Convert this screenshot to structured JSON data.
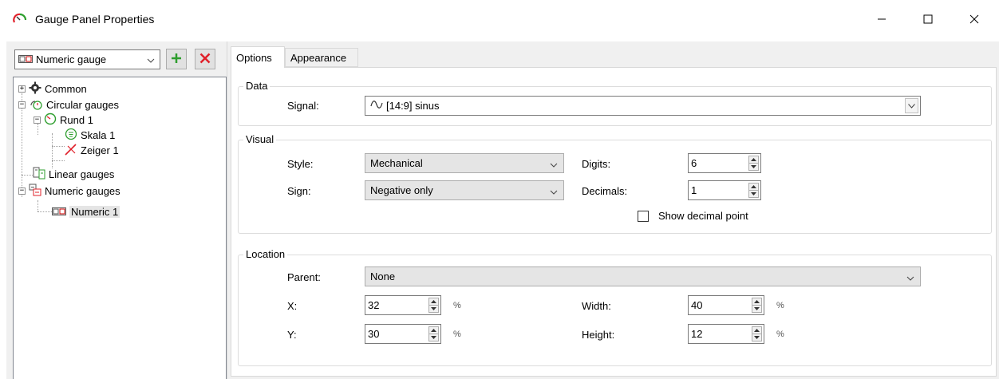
{
  "window": {
    "title": "Gauge Panel Properties",
    "minimize_glyph": "—",
    "maximize_glyph": "☐",
    "close_glyph": "✕"
  },
  "left": {
    "preset": {
      "value": "Numeric gauge",
      "icon": "numeric-gauge-icon"
    },
    "add_icon": "plus-icon",
    "delete_icon": "x-icon",
    "accent": {
      "add": "#2e9e2e",
      "delete": "#e0202a"
    },
    "tree": [
      {
        "label": "Common",
        "icon": "gear-icon",
        "level": 0,
        "expander": "+"
      },
      {
        "label": "Circular gauges",
        "icon": "circular-gauges-icon",
        "level": 0,
        "expander": "−"
      },
      {
        "label": "Rund 1",
        "icon": "gauge-icon",
        "level": 1,
        "expander": "−"
      },
      {
        "label": "Skala 1",
        "icon": "scale-icon",
        "level": 2
      },
      {
        "label": "Zeiger 1",
        "icon": "pointer-icon",
        "level": 2
      },
      {
        "label": "Linear gauges",
        "icon": "linear-gauge-icon",
        "level": 0
      },
      {
        "label": "Numeric gauges",
        "icon": "numeric-gauges-icon",
        "level": 0,
        "expander": "−"
      },
      {
        "label": "Numeric 1",
        "icon": "numeric-gauge-icon",
        "level": 1,
        "selected": true
      }
    ]
  },
  "tabs": [
    {
      "label": "Options",
      "active": true
    },
    {
      "label": "Appearance",
      "active": false
    }
  ],
  "data_group": {
    "title": "Data",
    "signal_label": "Signal:",
    "signal_value": "[14:9] sinus",
    "signal_icon": "sine-wave-icon"
  },
  "visual_group": {
    "title": "Visual",
    "style_label": "Style:",
    "style_value": "Mechanical",
    "sign_label": "Sign:",
    "sign_value": "Negative only",
    "digits_label": "Digits:",
    "digits_value": "6",
    "decimals_label": "Decimals:",
    "decimals_value": "1",
    "show_decimal_point_label": "Show decimal point",
    "show_decimal_point_checked": false
  },
  "location_group": {
    "title": "Location",
    "parent_label": "Parent:",
    "parent_value": "None",
    "x_label": "X:",
    "x_value": "32",
    "y_label": "Y:",
    "y_value": "30",
    "width_label": "Width:",
    "width_value": "40",
    "height_label": "Height:",
    "height_value": "12",
    "unit": "%"
  }
}
